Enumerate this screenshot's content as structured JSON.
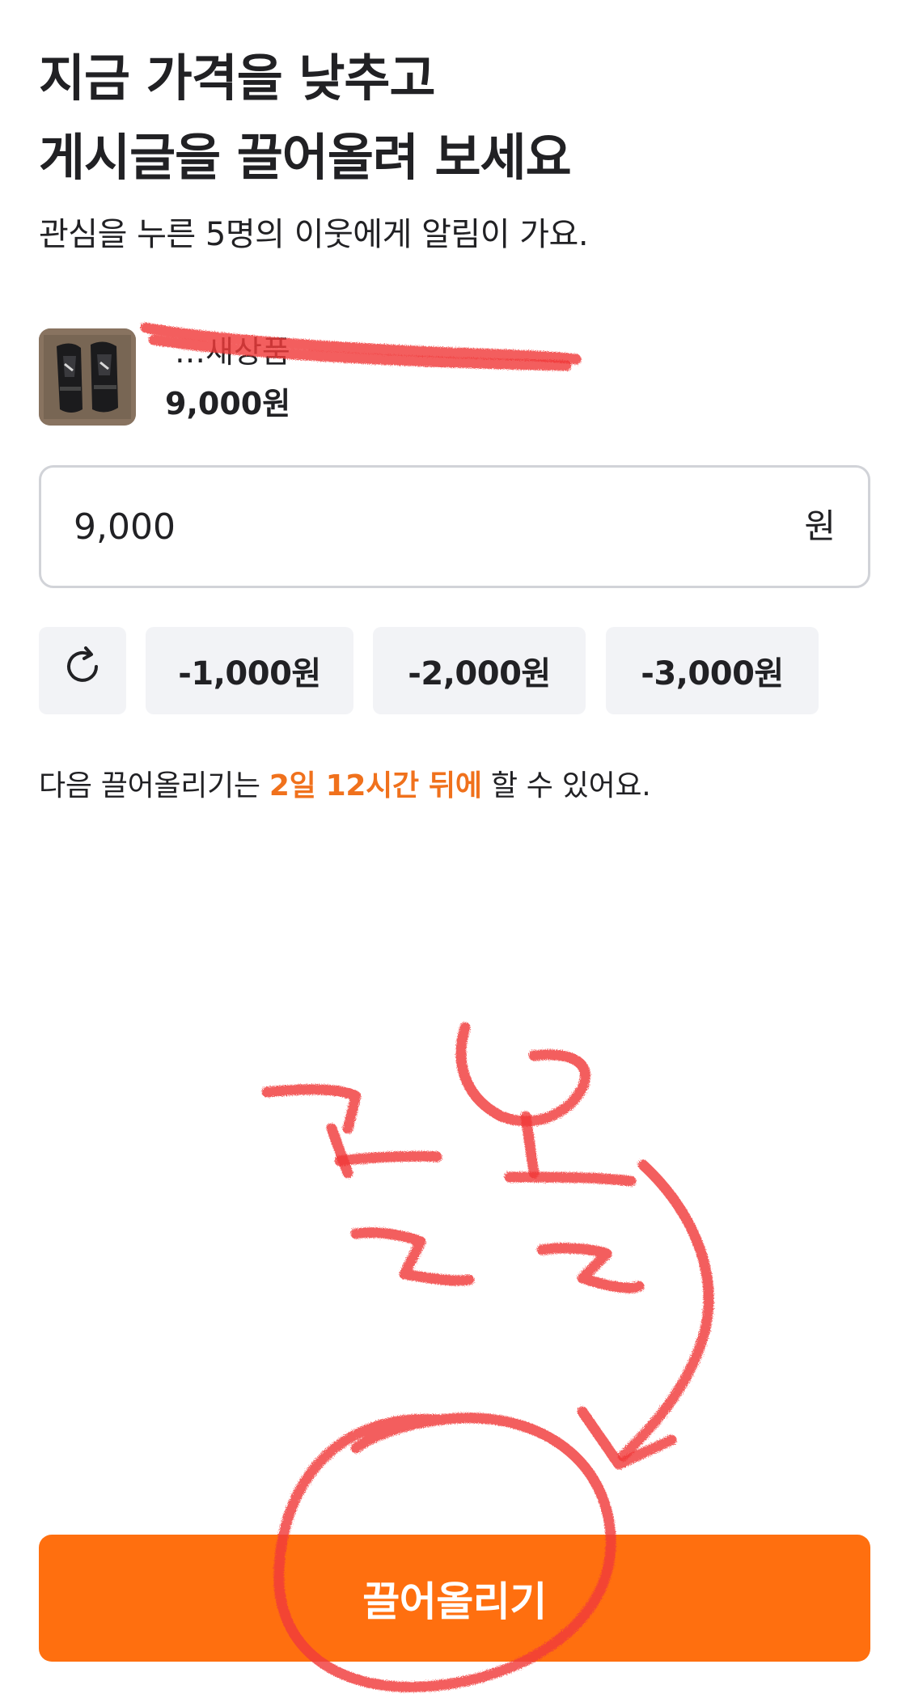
{
  "header": {
    "title_line1": "지금 가격을 낮추고",
    "title_line2": "게시글을 끌어올려 보세요",
    "subtitle": "관심을 누른 5명의 이웃에게 알림이 가요."
  },
  "product": {
    "name": "…새상품",
    "price": "9,000원",
    "thumbnail_icon": "shin-guards-photo"
  },
  "price_input": {
    "value": "9,000",
    "unit": "원"
  },
  "discount_chips": {
    "reset_icon": "refresh-icon",
    "minus_1000": "-1,000원",
    "minus_2000": "-2,000원",
    "minus_3000": "-3,000원"
  },
  "notice": {
    "prefix": "다음 끌어올리기는 ",
    "highlight": "2일 12시간 뒤에",
    "suffix": " 할 수 있어요."
  },
  "cta": {
    "label": "끌어올리기"
  },
  "annotation": {
    "scribble_text": "끌올",
    "stroke_color": "#f03a3a"
  },
  "colors": {
    "accent": "#ff6f0f",
    "highlight_text": "#f0711c",
    "chip_bg": "#f2f3f6",
    "border": "#d1d3d8"
  }
}
